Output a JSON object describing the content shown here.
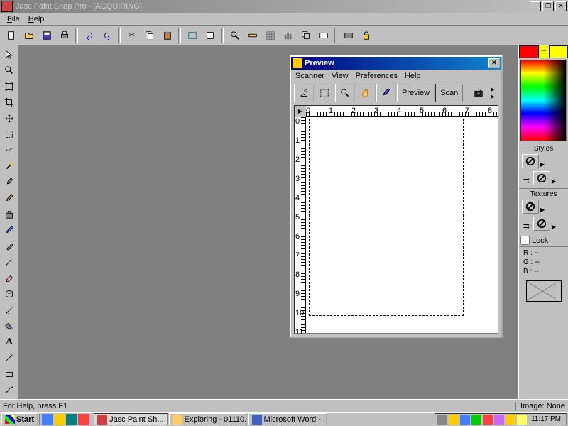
{
  "app": {
    "title": "Jasc Paint Shop Pro - [ACQUIRING]"
  },
  "menu": {
    "file": "File",
    "help": "Help"
  },
  "preview": {
    "title": "Preview",
    "menu": {
      "scanner": "Scanner",
      "view": "View",
      "preferences": "Preferences",
      "help": "Help"
    },
    "buttons": {
      "preview": "Preview",
      "scan": "Scan"
    },
    "ruler_h": [
      "0",
      "1",
      "2",
      "3",
      "4",
      "5",
      "6",
      "7",
      "8"
    ],
    "ruler_v": [
      "0",
      "1",
      "2",
      "3",
      "4",
      "5",
      "6",
      "7",
      "8",
      "9",
      "10",
      "11"
    ]
  },
  "rightpanel": {
    "styles_label": "Styles",
    "textures_label": "Textures",
    "lock_label": "Lock",
    "rgb": {
      "r": "R :  --",
      "g": "G :  --",
      "b": "B :  --"
    }
  },
  "status": {
    "help": "For Help, press F1",
    "image": "Image: None"
  },
  "taskbar": {
    "start": "Start",
    "tasks": [
      {
        "label": "Jasc Paint Sh...",
        "active": true
      },
      {
        "label": "Exploring - 01110...",
        "active": false
      },
      {
        "label": "Microsoft Word - ...",
        "active": false
      }
    ],
    "clock": "11:17 PM"
  }
}
